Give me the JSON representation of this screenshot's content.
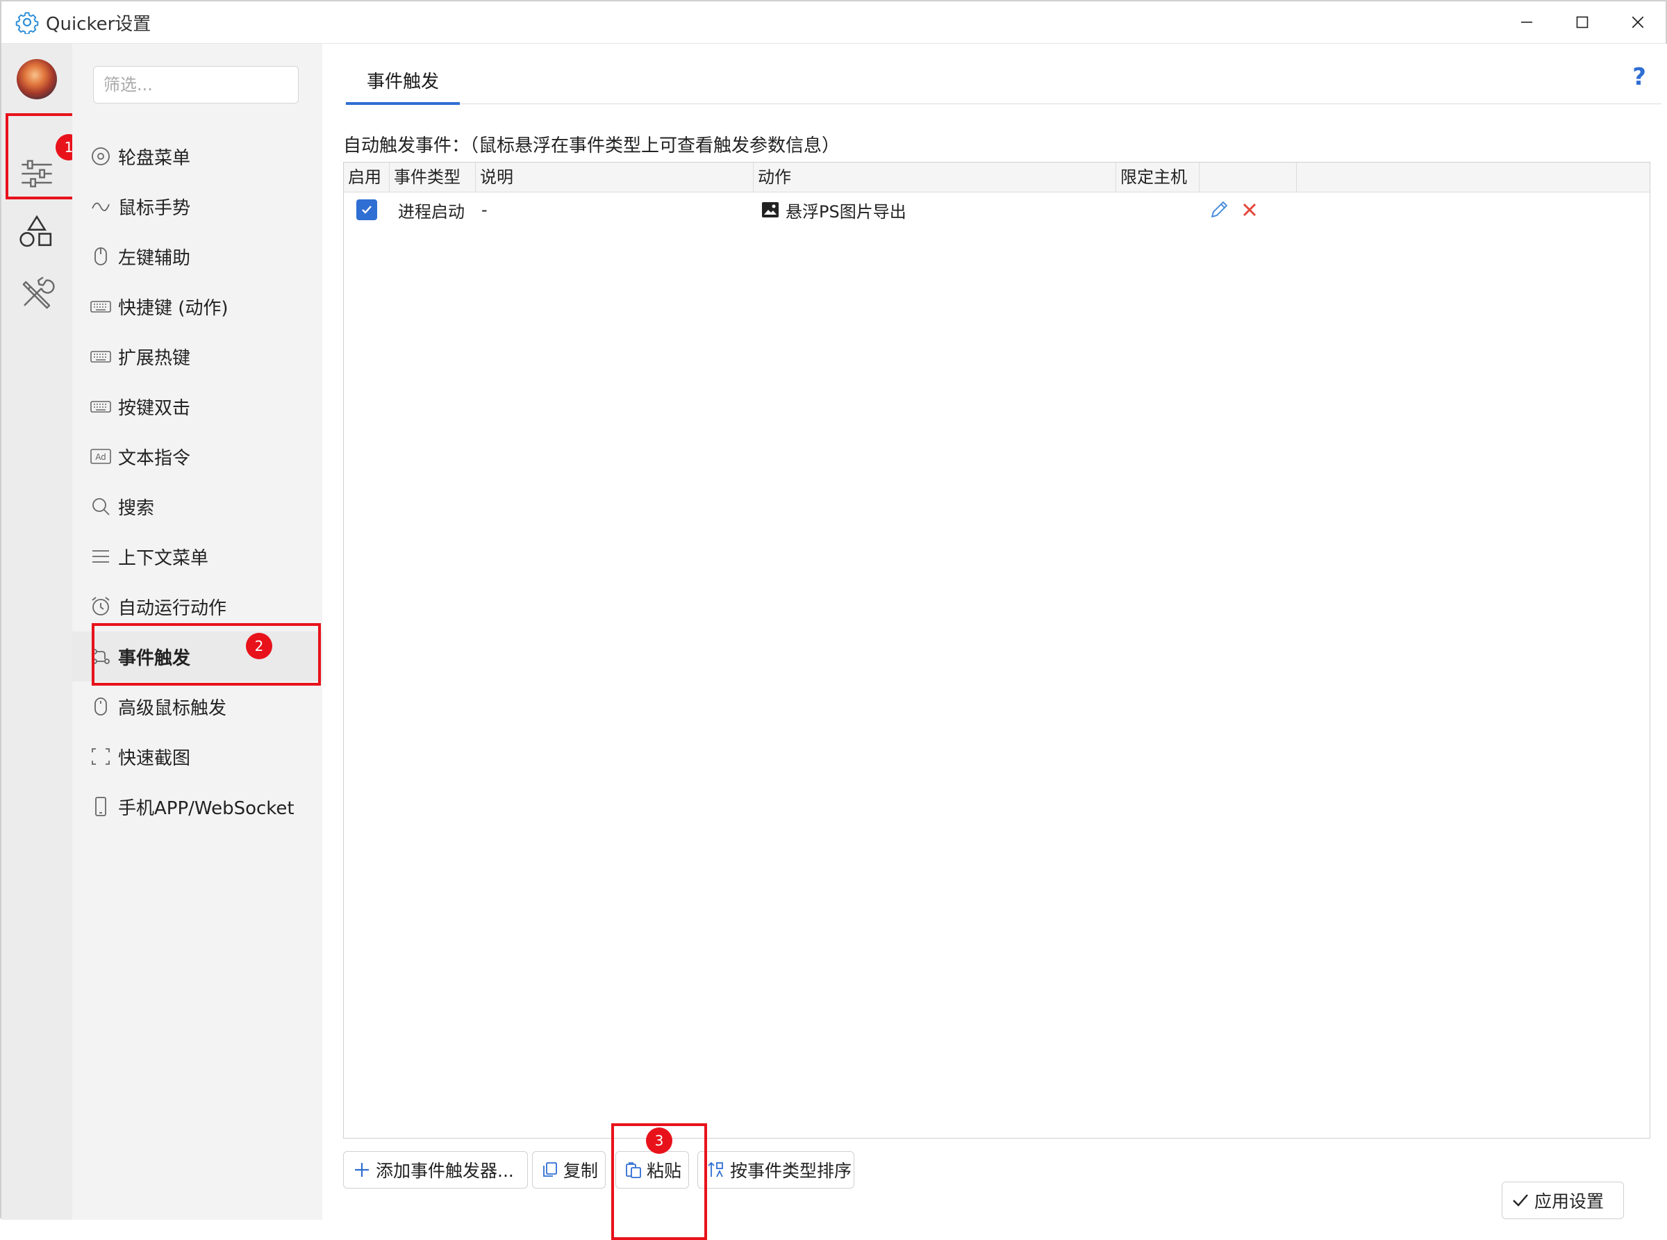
{
  "window": {
    "title": "Quicker设置",
    "buttons": [
      "minimize",
      "maximize",
      "close"
    ]
  },
  "rail": {
    "items": [
      {
        "name": "avatar"
      },
      {
        "name": "sliders-icon"
      },
      {
        "name": "shapes-icon"
      },
      {
        "name": "tools-icon"
      }
    ]
  },
  "nav": {
    "filter_placeholder": "筛选...",
    "items": [
      {
        "label": "轮盘菜单",
        "icon": "wheel-icon"
      },
      {
        "label": "鼠标手势",
        "icon": "gesture-icon"
      },
      {
        "label": "左键辅助",
        "icon": "mouse-icon"
      },
      {
        "label": "快捷键 (动作)",
        "icon": "keyboard-icon"
      },
      {
        "label": "扩展热键",
        "icon": "keyboard-icon"
      },
      {
        "label": "按键双击",
        "icon": "keyboard-icon"
      },
      {
        "label": "文本指令",
        "icon": "ad-icon"
      },
      {
        "label": "搜索",
        "icon": "search-icon"
      },
      {
        "label": "上下文菜单",
        "icon": "menu-icon"
      },
      {
        "label": "自动运行动作",
        "icon": "alarm-icon"
      },
      {
        "label": "事件触发",
        "icon": "event-icon",
        "active": true
      },
      {
        "label": "高级鼠标触发",
        "icon": "mouse-icon"
      },
      {
        "label": "快速截图",
        "icon": "screenshot-icon"
      },
      {
        "label": "手机APP/WebSocket",
        "icon": "phone-icon"
      }
    ]
  },
  "main": {
    "tab": "事件触发",
    "help": "?",
    "section_label": "自动触发事件：（鼠标悬浮在事件类型上可查看触发参数信息）",
    "columns": [
      "启用",
      "事件类型",
      "说明",
      "动作",
      "限定主机",
      ""
    ],
    "rows": [
      {
        "enabled": true,
        "type": "进程启动",
        "desc": "-",
        "action": "悬浮PS图片导出",
        "host": ""
      }
    ],
    "buttons": {
      "add": "添加事件触发器...",
      "copy": "复制",
      "paste": "粘贴",
      "sort": "按事件类型排序",
      "apply": "应用设置"
    }
  },
  "annotations": [
    "1",
    "2",
    "3"
  ],
  "colors": {
    "accent": "#2f6ed3",
    "annotation": "#e8121b",
    "delete": "#e5483b"
  }
}
